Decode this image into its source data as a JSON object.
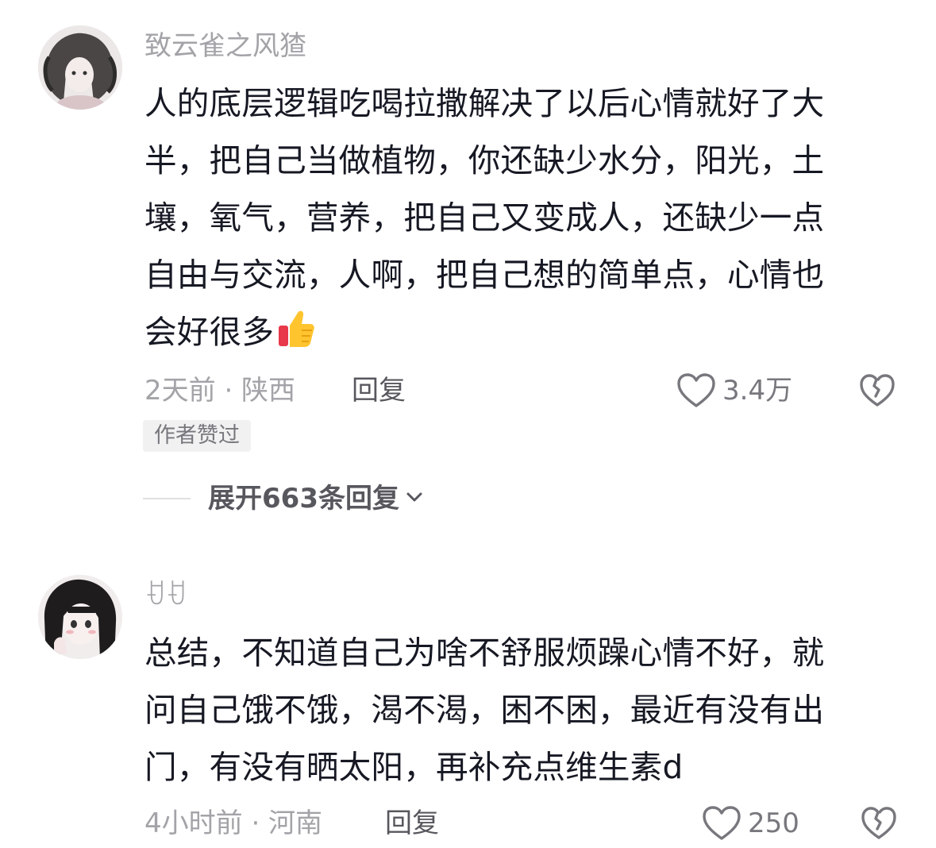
{
  "comments": [
    {
      "username": "致云雀之风猹",
      "lines": [
        "人的底层逻辑吃喝拉撒解决了以后心情就好了大",
        "半，把自己当做植物，你还缺少水分，阳光，土",
        "壤，氧气，营养，把自己又变成人，还缺少一点",
        "自由与交流，人啊，把自己想的简单点，心情也",
        "会好很多"
      ],
      "emoji": "thumbs-up-icon",
      "time_location": "2天前 · 陕西",
      "reply_label": "回复",
      "likes": "3.4万",
      "badge": "作者赞过",
      "expand_label": "展开663条回复"
    },
    {
      "username": "ꀀꀀ",
      "lines": [
        "总结，不知道自己为啥不舒服烦躁心情不好，就",
        "问自己饿不饿，渴不渴，困不困，最近有没有出",
        "门，有没有晒太阳，再补充点维生素d"
      ],
      "time_location": "4小时前 · 河南",
      "reply_label": "回复",
      "likes": "250"
    }
  ],
  "colors": {
    "text_primary": "#161823",
    "text_secondary": "#a3a3a8",
    "text_action": "#57575e",
    "badge_bg": "#f1f1f2"
  }
}
